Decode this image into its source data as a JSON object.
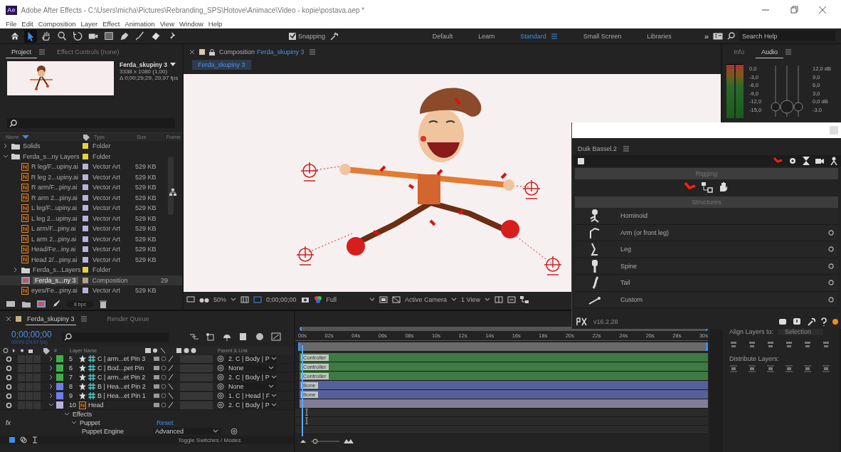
{
  "window": {
    "app_icon": "Ae",
    "title": "Adobe After Effects - C:\\Users\\micha\\Pictures\\Rebranding_SPS\\Hotove\\Animace\\Video - kopie\\postava.aep *"
  },
  "menu": [
    "File",
    "Edit",
    "Composition",
    "Layer",
    "Effect",
    "Animation",
    "View",
    "Window",
    "Help"
  ],
  "toolbar": {
    "tools": [
      {
        "kind": "home",
        "selected": false
      },
      {
        "kind": "select",
        "selected": true
      },
      {
        "kind": "hand",
        "selected": false
      },
      {
        "kind": "zoom",
        "selected": false
      },
      {
        "kind": "rotate",
        "selected": false
      },
      {
        "kind": "camera",
        "selected": false
      },
      {
        "kind": "rect",
        "selected": false
      },
      {
        "kind": "pen",
        "selected": false
      },
      {
        "kind": "brush",
        "selected": false
      },
      {
        "kind": "eraser",
        "selected": false
      },
      {
        "kind": "pin",
        "selected": false
      }
    ],
    "snapping": {
      "label": "Snapping",
      "checked": true
    },
    "workspaces": [
      {
        "label": "Default",
        "selected": false
      },
      {
        "label": "Learn",
        "selected": false
      },
      {
        "label": "Standard",
        "selected": true
      },
      {
        "label": "Small Screen",
        "selected": false
      },
      {
        "label": "Libraries",
        "selected": false
      }
    ],
    "more": "»",
    "search": {
      "placeholder": "Search Help"
    }
  },
  "project": {
    "tabs": [
      {
        "label": "Project",
        "selected": true
      },
      {
        "label": "Effect Controls (none)",
        "selected": false
      }
    ],
    "comp_info": {
      "name": "Ferda_skupiny 3",
      "size": "3338 x 1080 (1,00)",
      "duration": "Δ 0;00;29;29, 29,97 fps"
    },
    "columns": [
      "Name",
      "Type",
      "Size",
      "Frame"
    ],
    "items": [
      {
        "kind": "folder",
        "name": "Solids",
        "type": "Folder",
        "color": "#e3d43c",
        "selected": false,
        "expanded": false
      },
      {
        "kind": "folder",
        "name": "Ferda_s...ny Layers",
        "type": "Folder",
        "color": "#e3d43c",
        "selected": false,
        "expanded": true,
        "children": [
          {
            "kind": "vector",
            "name": "R leg/F...upiny.ai",
            "type": "Vector Art",
            "size": "529 KB",
            "color": "#b7b3de",
            "selected": false
          },
          {
            "kind": "vector",
            "name": "R leg 2...upiny.ai",
            "type": "Vector Art",
            "size": "529 KB",
            "color": "#b7b3de",
            "selected": false
          },
          {
            "kind": "vector",
            "name": "R arm/F...piny.ai",
            "type": "Vector Art",
            "size": "529 KB",
            "color": "#b7b3de",
            "selected": false
          },
          {
            "kind": "vector",
            "name": "R arm 2...piny.ai",
            "type": "Vector Art",
            "size": "529 KB",
            "color": "#b7b3de",
            "selected": false
          },
          {
            "kind": "vector",
            "name": "L leg/F...upiny.ai",
            "type": "Vector Art",
            "size": "529 KB",
            "color": "#b7b3de",
            "selected": false
          },
          {
            "kind": "vector",
            "name": "L leg 2...upiny.ai",
            "type": "Vector Art",
            "size": "529 KB",
            "color": "#b7b3de",
            "selected": false
          },
          {
            "kind": "vector",
            "name": "L arm/F...piny.ai",
            "type": "Vector Art",
            "size": "529 KB",
            "color": "#b7b3de",
            "selected": false
          },
          {
            "kind": "vector",
            "name": "L arm 2...piny.ai",
            "type": "Vector Art",
            "size": "529 KB",
            "color": "#b7b3de",
            "selected": false
          },
          {
            "kind": "vector",
            "name": "Head/Fe...iny.ai",
            "type": "Vector Art",
            "size": "529 KB",
            "color": "#b7b3de",
            "selected": false
          },
          {
            "kind": "vector",
            "name": "Head 2/...piny.ai",
            "type": "Vector Art",
            "size": "529 KB",
            "color": "#b7b3de",
            "selected": false
          },
          {
            "kind": "folder",
            "name": "Ferda_s...Layers",
            "type": "Folder",
            "color": "#e3d43c",
            "selected": false,
            "expanded": false
          },
          {
            "kind": "composition",
            "name": "Ferda_s...ny 3",
            "type": "Composition",
            "frame": "29",
            "color": "#b3a383",
            "selected": true
          },
          {
            "kind": "vector",
            "name": "eyes/Fe...piny.ai",
            "type": "Vector Art",
            "size": "529 KB",
            "color": "#b7b3de",
            "selected": false
          }
        ]
      }
    ],
    "footer": {
      "bpc": "8 bpc"
    }
  },
  "composition": {
    "tab": "Composition",
    "comp_name": "Ferda_skupiny 3",
    "sub_tab": "Ferda_skupiny 3",
    "footer": {
      "zoom": "50%",
      "timecode": "0;00;00;00",
      "resolution": "Full",
      "camera": "Active Camera",
      "views": "1 View"
    }
  },
  "audio": {
    "tabs": [
      {
        "label": "Info",
        "selected": false
      },
      {
        "label": "Audio",
        "selected": true
      }
    ],
    "left_scale": [
      "0,0",
      "-3,0",
      "-6,0",
      "-9,0",
      "-12,0",
      "-15,0"
    ],
    "right_scale": [
      "12,0 dB",
      "9,0",
      "6,0",
      "3,0",
      "0,0 dB",
      "-3,0"
    ]
  },
  "duik": {
    "title": "Duik Bassel.2",
    "rigging": "Rigging",
    "structures_title": "Structures",
    "structures": [
      {
        "kind": "hominoid",
        "label": "Hominoid",
        "options": false
      },
      {
        "kind": "arm",
        "label": "Arm (or front leg)",
        "options": true
      },
      {
        "kind": "leg",
        "label": "Leg",
        "options": true
      },
      {
        "kind": "spine",
        "label": "Spine",
        "options": true
      },
      {
        "kind": "tail",
        "label": "Tail",
        "options": true
      },
      {
        "kind": "custom",
        "label": "Custom",
        "options": true
      }
    ],
    "version": "v16.2.28"
  },
  "timeline": {
    "tabs": [
      {
        "label": "Ferda_skupiny 3",
        "selected": true
      },
      {
        "label": "Render Queue",
        "selected": false
      }
    ],
    "timecode": "0;00;00;00",
    "fps": "00000 (29.97 fps)",
    "columns": {
      "number": "#",
      "layer_name": "Layer Name",
      "parent": "Parent & Link"
    },
    "layers": [
      {
        "kind": "shape",
        "number": "5",
        "name": "C | arm...et Pin 3",
        "color": "#3fae49",
        "parent": "2. C | Body | P",
        "bar_label": "Controller",
        "expanded": false
      },
      {
        "kind": "shape",
        "number": "6",
        "name": "C | Bod...pet Pin",
        "color": "#3fae49",
        "parent": "None",
        "bar_label": "Controller",
        "expanded": false
      },
      {
        "kind": "shape",
        "number": "7",
        "name": "C | arm...et Pin 2",
        "color": "#3fae49",
        "parent": "2. C | Body | P",
        "bar_label": "Controller",
        "expanded": false
      },
      {
        "kind": "shape",
        "number": "8",
        "name": "B | Hea...et Pin 2",
        "color": "#6d7ee8",
        "parent": "None",
        "bar_label": "Bone",
        "expanded": false
      },
      {
        "kind": "shape",
        "number": "9",
        "name": "B | Hea...et Pin 1",
        "color": "#6d7ee8",
        "parent": "1. C | Head | F",
        "bar_label": "Bone",
        "expanded": false
      },
      {
        "kind": "vector",
        "number": "10",
        "name": "Head",
        "color": "#b7b3de",
        "parent": "2. C | Body | P",
        "expanded": true
      }
    ],
    "effects": {
      "label": "Effects",
      "fx": "fx",
      "effect": "Puppet",
      "reset": "Reset",
      "property": "Puppet Engine",
      "value": "Advanced"
    },
    "ticks": [
      "00s",
      "02s",
      "04s",
      "06s",
      "08s",
      "10s",
      "12s",
      "14s",
      "16s",
      "18s",
      "20s",
      "22s",
      "24s",
      "26s",
      "28s",
      "30s"
    ],
    "footer": "Toggle Switches / Modes"
  },
  "align": {
    "title": "Align Layers to:",
    "target": "Selection",
    "distribute": "Distribute Layers:"
  }
}
